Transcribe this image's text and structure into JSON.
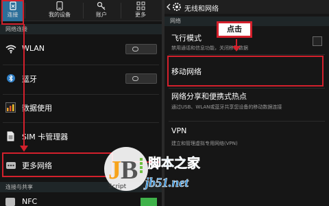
{
  "left": {
    "tabs": [
      {
        "label": "连接",
        "icon": "link-icon"
      },
      {
        "label": "我的设备",
        "icon": "phone-icon"
      },
      {
        "label": "账户",
        "icon": "key-icon"
      },
      {
        "label": "更多",
        "icon": "grid-icon"
      }
    ],
    "section_network": "网络连接",
    "items": [
      {
        "label": "WLAN",
        "icon": "wifi-icon"
      },
      {
        "label": "蓝牙",
        "icon": "bluetooth-icon"
      },
      {
        "label": "数据使用",
        "icon": "data-usage-icon"
      },
      {
        "label": "SIM 卡管理器",
        "icon": "sim-card-icon"
      },
      {
        "label": "更多网络",
        "icon": "more-dots-icon"
      }
    ],
    "section_share": "连接与共享",
    "nfc_label": "NFC"
  },
  "right": {
    "header_title": "无线和网络",
    "section": "网络",
    "callout": "点击",
    "items": [
      {
        "title": "飞行模式",
        "subtitle": "禁用通话和信息功能，关闭移动数据"
      },
      {
        "title": "移动网络",
        "subtitle": ""
      },
      {
        "title": "网络分享和便携式热点",
        "subtitle": "通过USB、WLAN或蓝牙共享您设备的移动数据连接"
      },
      {
        "title": "VPN",
        "subtitle": "建立和管理虚拟专用网络(VPN)"
      }
    ]
  },
  "watermark": {
    "logo": "JB",
    "script": "Script",
    "cn": "脚本之家",
    "url": "jb51.net"
  },
  "colors": {
    "annotation_red": "#d4202c",
    "selected_tab": "#2c6f9a",
    "toggle_on": "#3fb24a"
  }
}
